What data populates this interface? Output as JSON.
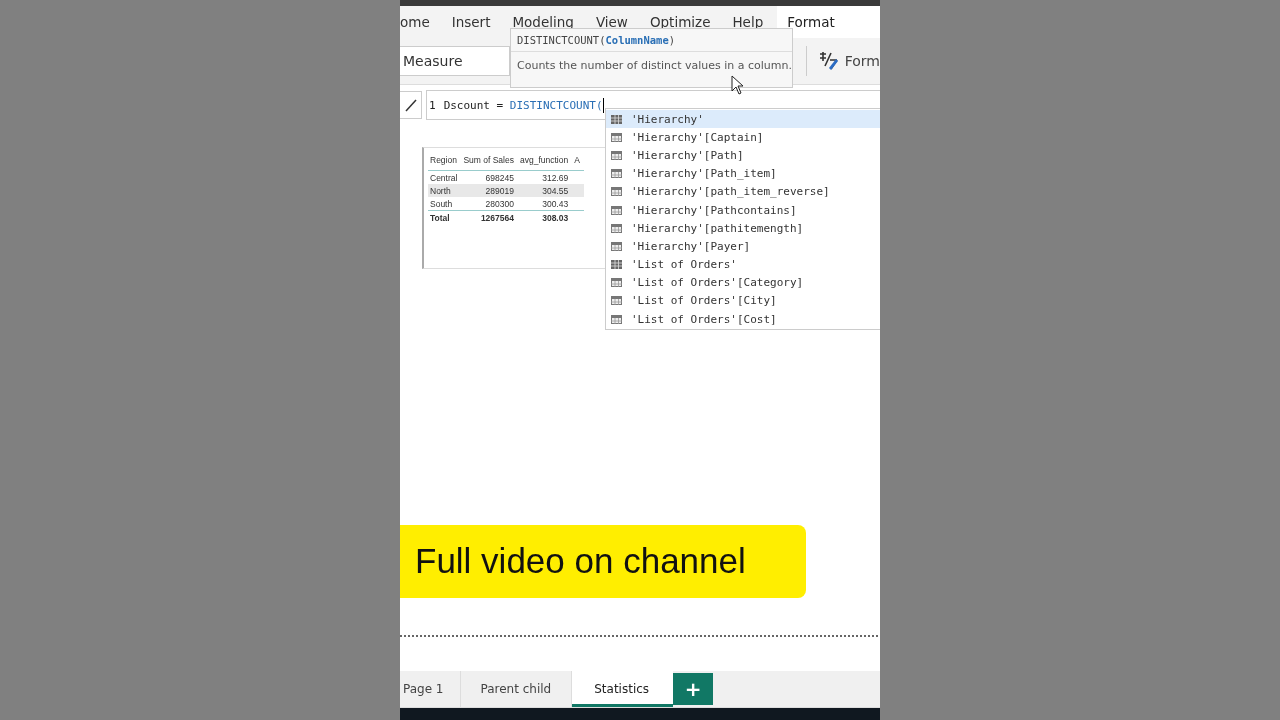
{
  "ribbon": {
    "tabs": [
      {
        "label": "ome",
        "selected": false
      },
      {
        "label": "Insert",
        "selected": false
      },
      {
        "label": "Modeling",
        "selected": false
      },
      {
        "label": "View",
        "selected": false
      },
      {
        "label": "Optimize",
        "selected": false
      },
      {
        "label": "Help",
        "selected": false
      },
      {
        "label": "Format",
        "selected": true
      }
    ],
    "name_field": {
      "value": "Measure"
    },
    "format_button": {
      "label": "Form"
    }
  },
  "formula_bar": {
    "line_number": "1",
    "formula": "Dscount = *DISTINCTCOUNT(*"
  },
  "tooltip": {
    "signature": "DISTINCTCOUNT(**ColumnName**)",
    "description": "Counts the number of distinct values in a column."
  },
  "autocomplete": [
    {
      "label": "'Hierarchy'",
      "kind": "table",
      "selected": true
    },
    {
      "label": "'Hierarchy'[Captain]",
      "kind": "column",
      "selected": false
    },
    {
      "label": "'Hierarchy'[Path]",
      "kind": "column",
      "selected": false
    },
    {
      "label": "'Hierarchy'[Path_item]",
      "kind": "column",
      "selected": false
    },
    {
      "label": "'Hierarchy'[path_item_reverse]",
      "kind": "column",
      "selected": false
    },
    {
      "label": "'Hierarchy'[Pathcontains]",
      "kind": "column",
      "selected": false
    },
    {
      "label": "'Hierarchy'[pathitemength]",
      "kind": "column",
      "selected": false
    },
    {
      "label": "'Hierarchy'[Payer]",
      "kind": "column",
      "selected": false
    },
    {
      "label": "'List of Orders'",
      "kind": "table",
      "selected": false
    },
    {
      "label": "'List of Orders'[Category]",
      "kind": "column",
      "selected": false
    },
    {
      "label": "'List of Orders'[City]",
      "kind": "column",
      "selected": false
    },
    {
      "label": "'List of Orders'[Cost]",
      "kind": "column",
      "selected": false
    }
  ],
  "table": {
    "columns": [
      "Region",
      "Sum of Sales",
      "avg_function",
      "A"
    ],
    "rows": [
      {
        "cells": [
          "Central",
          "698245",
          "312.69"
        ],
        "highlighted": false
      },
      {
        "cells": [
          "North",
          "289019",
          "304.55"
        ],
        "highlighted": true
      },
      {
        "cells": [
          "South",
          "280300",
          "300.43"
        ],
        "highlighted": false
      }
    ],
    "total": [
      "Total",
      "1267564",
      "308.03"
    ]
  },
  "banner": {
    "text": "Full video on channel"
  },
  "page_tabs": [
    {
      "label": "Page 1",
      "selected": false
    },
    {
      "label": "Parent child",
      "selected": false
    },
    {
      "label": "Statistics",
      "selected": true
    }
  ],
  "add_page_button": {
    "label": "+"
  }
}
